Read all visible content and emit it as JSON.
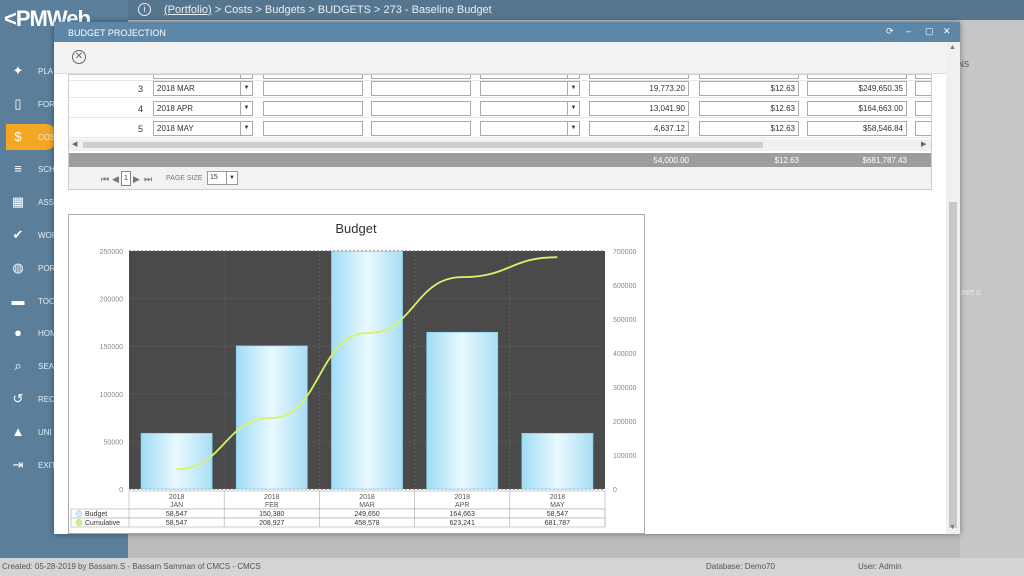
{
  "app": {
    "logo_text": "PMWeb"
  },
  "breadcrumb": {
    "portfolio": "(Portfolio)",
    "rest": " > Costs > Budgets > BUDGETS > 273 - Baseline Budget"
  },
  "sidebar": {
    "items": [
      {
        "label": "PLA",
        "icon": "lightbulb-icon",
        "glyph": "✦"
      },
      {
        "label": "FOR",
        "icon": "document-icon",
        "glyph": "▯"
      },
      {
        "label": "COS",
        "icon": "dollar-icon",
        "glyph": "$",
        "active": true
      },
      {
        "label": "SCH",
        "icon": "schedule-icon",
        "glyph": "≡"
      },
      {
        "label": "ASS",
        "icon": "asset-icon",
        "glyph": "▦"
      },
      {
        "label": "WOR",
        "icon": "check-icon",
        "glyph": "✔"
      },
      {
        "label": "POR",
        "icon": "globe-icon",
        "glyph": "◍"
      },
      {
        "label": "TOO",
        "icon": "toolbox-icon",
        "glyph": "▬"
      },
      {
        "label": "HOM",
        "icon": "user-icon",
        "glyph": "●"
      },
      {
        "label": "SEA",
        "icon": "search-icon",
        "glyph": "⌕"
      },
      {
        "label": "REC",
        "icon": "history-icon",
        "glyph": "↺"
      },
      {
        "label": "UNI",
        "icon": "graduation-icon",
        "glyph": "▲"
      },
      {
        "label": "EXIT",
        "icon": "exit-icon",
        "glyph": "⇥"
      }
    ]
  },
  "background": {
    "tab_label": "NS",
    "col_label": "UNIT C"
  },
  "modal": {
    "title": "BUDGET PROJECTION",
    "controls": {
      "refresh": "⟳",
      "minimize": "–",
      "restore": "▢",
      "close": "✕"
    },
    "close_circle": "✕"
  },
  "grid": {
    "rows": [
      {
        "num": "3",
        "period": "2018 MAR",
        "amount": "19,773.20",
        "rate": "$12.63",
        "total": "$249,650.35"
      },
      {
        "num": "4",
        "period": "2018 APR",
        "amount": "13,041.90",
        "rate": "$12.63",
        "total": "$164,663.00"
      },
      {
        "num": "5",
        "period": "2018 MAY",
        "amount": "4,637.12",
        "rate": "$12.63",
        "total": "$58,546.84"
      }
    ],
    "totals": {
      "amount": "54,000.00",
      "rate": "$12.63",
      "total": "$681,787.43"
    },
    "pager": {
      "page": "1",
      "page_size_label": "PAGE SIZE",
      "page_size": "15"
    }
  },
  "status": {
    "created": "Created:  05-28-2019 by Bassam.S - Bassam Samman of CMCS - CMCS",
    "database": "Database:   Demo70",
    "user": "User:  Admin"
  },
  "chart_data": {
    "type": "bar",
    "title": "Budget",
    "categories": [
      "2018 JAN",
      "2018 FEB",
      "2018 MAR",
      "2018 APR",
      "2018 MAY"
    ],
    "cat_line1": [
      "2018",
      "2018",
      "2018",
      "2018",
      "2018"
    ],
    "cat_line2": [
      "JAN",
      "FEB",
      "MAR",
      "APR",
      "MAY"
    ],
    "series": [
      {
        "name": "Budget",
        "values": [
          58547,
          150380,
          249650,
          164663,
          58547
        ],
        "labels": [
          "58,547",
          "150,380",
          "249,650",
          "164,663",
          "58,547"
        ],
        "color": "#cdeefa"
      },
      {
        "name": "Cumulative",
        "values": [
          58547,
          208927,
          458578,
          623241,
          681787
        ],
        "labels": [
          "58,547",
          "208,927",
          "458,578",
          "623,241",
          "681,787"
        ],
        "color": "#d7f36b",
        "axis": "right"
      }
    ],
    "ylim": [
      0,
      250000
    ],
    "y2lim": [
      0,
      700000
    ],
    "yticks": [
      "0",
      "50000",
      "100000",
      "150000",
      "200000",
      "250000"
    ],
    "y2ticks": [
      "0",
      "100000",
      "200000",
      "300000",
      "400000",
      "500000",
      "600000",
      "700000"
    ],
    "grid": true,
    "legend": "data-table-bottom",
    "plot_bg": "#4a4a4a"
  }
}
